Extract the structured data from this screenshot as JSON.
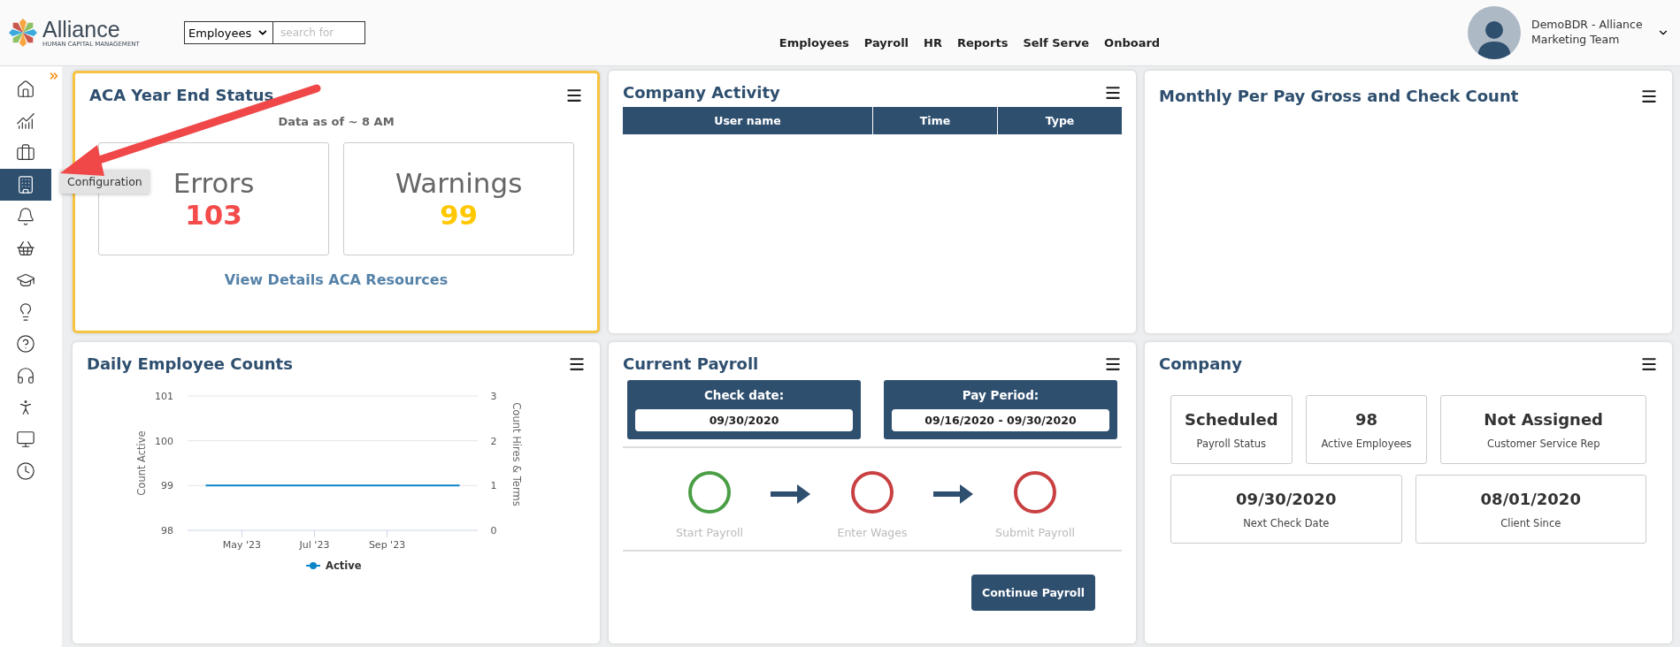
{
  "header": {
    "logo": {
      "name": "Alliance",
      "tagline": "HUMAN CAPITAL MANAGEMENT"
    },
    "search_scope": "Employees",
    "search": {
      "placeholder": "search for"
    },
    "nav": [
      "Employees",
      "Payroll",
      "HR",
      "Reports",
      "Self Serve",
      "Onboard"
    ],
    "user": {
      "name": "DemoBDR - Alliance Marketing Team"
    }
  },
  "sidebar": {
    "items": [
      {
        "selected": false
      },
      {
        "selected": false
      },
      {
        "selected": false
      },
      {
        "selected": true
      },
      {
        "selected": false
      },
      {
        "selected": false
      },
      {
        "selected": false
      },
      {
        "selected": false
      },
      {
        "selected": false
      },
      {
        "selected": false
      },
      {
        "selected": false
      },
      {
        "selected": false
      },
      {
        "selected": false
      }
    ],
    "tooltip": "Configuration"
  },
  "aca": {
    "title": "ACA Year End Status",
    "note": "Data as of ~ 8 AM",
    "tiles": [
      {
        "label": "Errors",
        "value": "103",
        "color": "#f44b4b"
      },
      {
        "label": "Warnings",
        "value": "99",
        "color": "#ffc800"
      }
    ],
    "link": "View Details ACA Resources"
  },
  "activity": {
    "title": "Company Activity",
    "columns": [
      "User name",
      "Time",
      "Type"
    ]
  },
  "monthly": {
    "title": "Monthly Per Pay Gross and Check Count"
  },
  "daily": {
    "title": "Daily Employee Counts",
    "chart_data": {
      "type": "line",
      "ylabel": "Count Active",
      "y2label": "Count Hires & Terms",
      "categories": [
        null,
        "May '23",
        null,
        "Jul '23",
        null,
        "Sep '23",
        null,
        null
      ],
      "ylim": [
        98,
        101
      ],
      "yticks": [
        98,
        99,
        100,
        101
      ],
      "y2ticks": [
        0,
        1,
        2,
        3
      ],
      "y2lim": [
        0,
        3
      ],
      "series": [
        {
          "name": "Active",
          "color": "#0a85c7",
          "values": [
            99,
            99,
            99,
            99,
            99,
            99,
            99,
            99
          ]
        }
      ]
    }
  },
  "payroll": {
    "title": "Current Payroll",
    "check_date": {
      "label": "Check date:",
      "value": "09/30/2020"
    },
    "pay_period": {
      "label": "Pay Period:",
      "value": "09/16/2020 - 09/30/2020"
    },
    "steps": [
      {
        "label": "Start Payroll",
        "color": "#4a9e45"
      },
      {
        "label": "Enter Wages",
        "color": "#c94043"
      },
      {
        "label": "Submit Payroll",
        "color": "#c94043"
      }
    ],
    "button": "Continue Payroll"
  },
  "company": {
    "title": "Company",
    "stats": [
      {
        "value": "Scheduled",
        "label": "Payroll Status"
      },
      {
        "value": "98",
        "label": "Active Employees"
      },
      {
        "value": "Not Assigned",
        "label": "Customer Service Rep"
      },
      {
        "value": "09/30/2020",
        "label": "Next Check Date"
      },
      {
        "value": "08/01/2020",
        "label": "Client Since"
      }
    ]
  }
}
